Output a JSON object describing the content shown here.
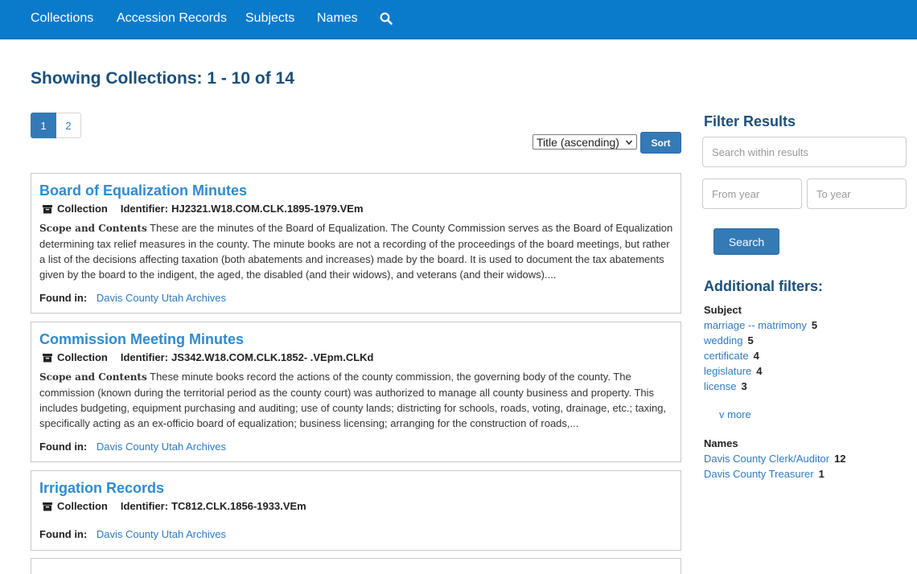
{
  "nav": {
    "items": [
      "Collections",
      "Accession Records",
      "Subjects",
      "Names"
    ],
    "search_icon": "search-icon"
  },
  "page_title": "Showing Collections: 1 - 10 of 14",
  "pagination": {
    "pages": [
      "1",
      "2"
    ],
    "active": "1"
  },
  "sort": {
    "selected": "Title (ascending)",
    "button": "Sort"
  },
  "results": [
    {
      "title": "Board of Equalization Minutes",
      "type": "Collection",
      "identifier_label": "Identifier:",
      "identifier": "HJ2321.W18.COM.CLK.1895-1979.VEm",
      "scope_label": "Scope and Contents",
      "scope": "These are the minutes of the Board of Equalization. The County Commission serves as the Board of Equalization determining tax relief measures in the county. The minute books are not a recording of the proceedings of the board meetings, but rather a list of the decisions affecting taxation (both abatements and increases) made by the board. It is used to document the tax abatements given by the board to the indigent, the aged, the disabled (and their widows), and veterans (and their widows)....",
      "found_label": "Found in:",
      "found_in": "Davis County Utah Archives"
    },
    {
      "title": "Commission Meeting Minutes",
      "type": "Collection",
      "identifier_label": "Identifier:",
      "identifier": "JS342.W18.COM.CLK.1852- .VEpm.CLKd",
      "scope_label": "Scope and Contents",
      "scope": "These minute books record the actions of the county commission, the governing body of the county. The commission (known during the territorial period as the county court) was authorized to manage all county business and property. This includes budgeting, equipment purchasing and auditing; use of county lands; districting for schools, roads, voting, drainage, etc.; taxing, specifically acting as an ex-officio board of equalization; business licensing; arranging for the construction of roads,...",
      "found_label": "Found in:",
      "found_in": "Davis County Utah Archives"
    },
    {
      "title": "Irrigation Records",
      "type": "Collection",
      "identifier_label": "Identifier:",
      "identifier": "TC812.CLK.1856-1933.VEm",
      "found_label": "Found in:",
      "found_in": "Davis County Utah Archives"
    }
  ],
  "sidebar": {
    "filter_title": "Filter Results",
    "search_placeholder": "Search within results",
    "from_year_placeholder": "From year",
    "to_year_placeholder": "To year",
    "search_button": "Search",
    "additional_title": "Additional filters:",
    "subject_label": "Subject",
    "subjects": [
      {
        "label": "marriage -- matrimony",
        "count": "5"
      },
      {
        "label": "wedding",
        "count": "5"
      },
      {
        "label": "certificate",
        "count": "4"
      },
      {
        "label": "legislature",
        "count": "4"
      },
      {
        "label": "license",
        "count": "3"
      }
    ],
    "more_label": "v more",
    "names_label": "Names",
    "names": [
      {
        "label": "Davis County Clerk/Auditor",
        "count": "12"
      },
      {
        "label": "Davis County Treasurer",
        "count": "1"
      }
    ]
  },
  "colors": {
    "nav_bg": "#0a7acb",
    "heading": "#1b4f7a",
    "link": "#2e7bbf",
    "button": "#337ab7"
  }
}
